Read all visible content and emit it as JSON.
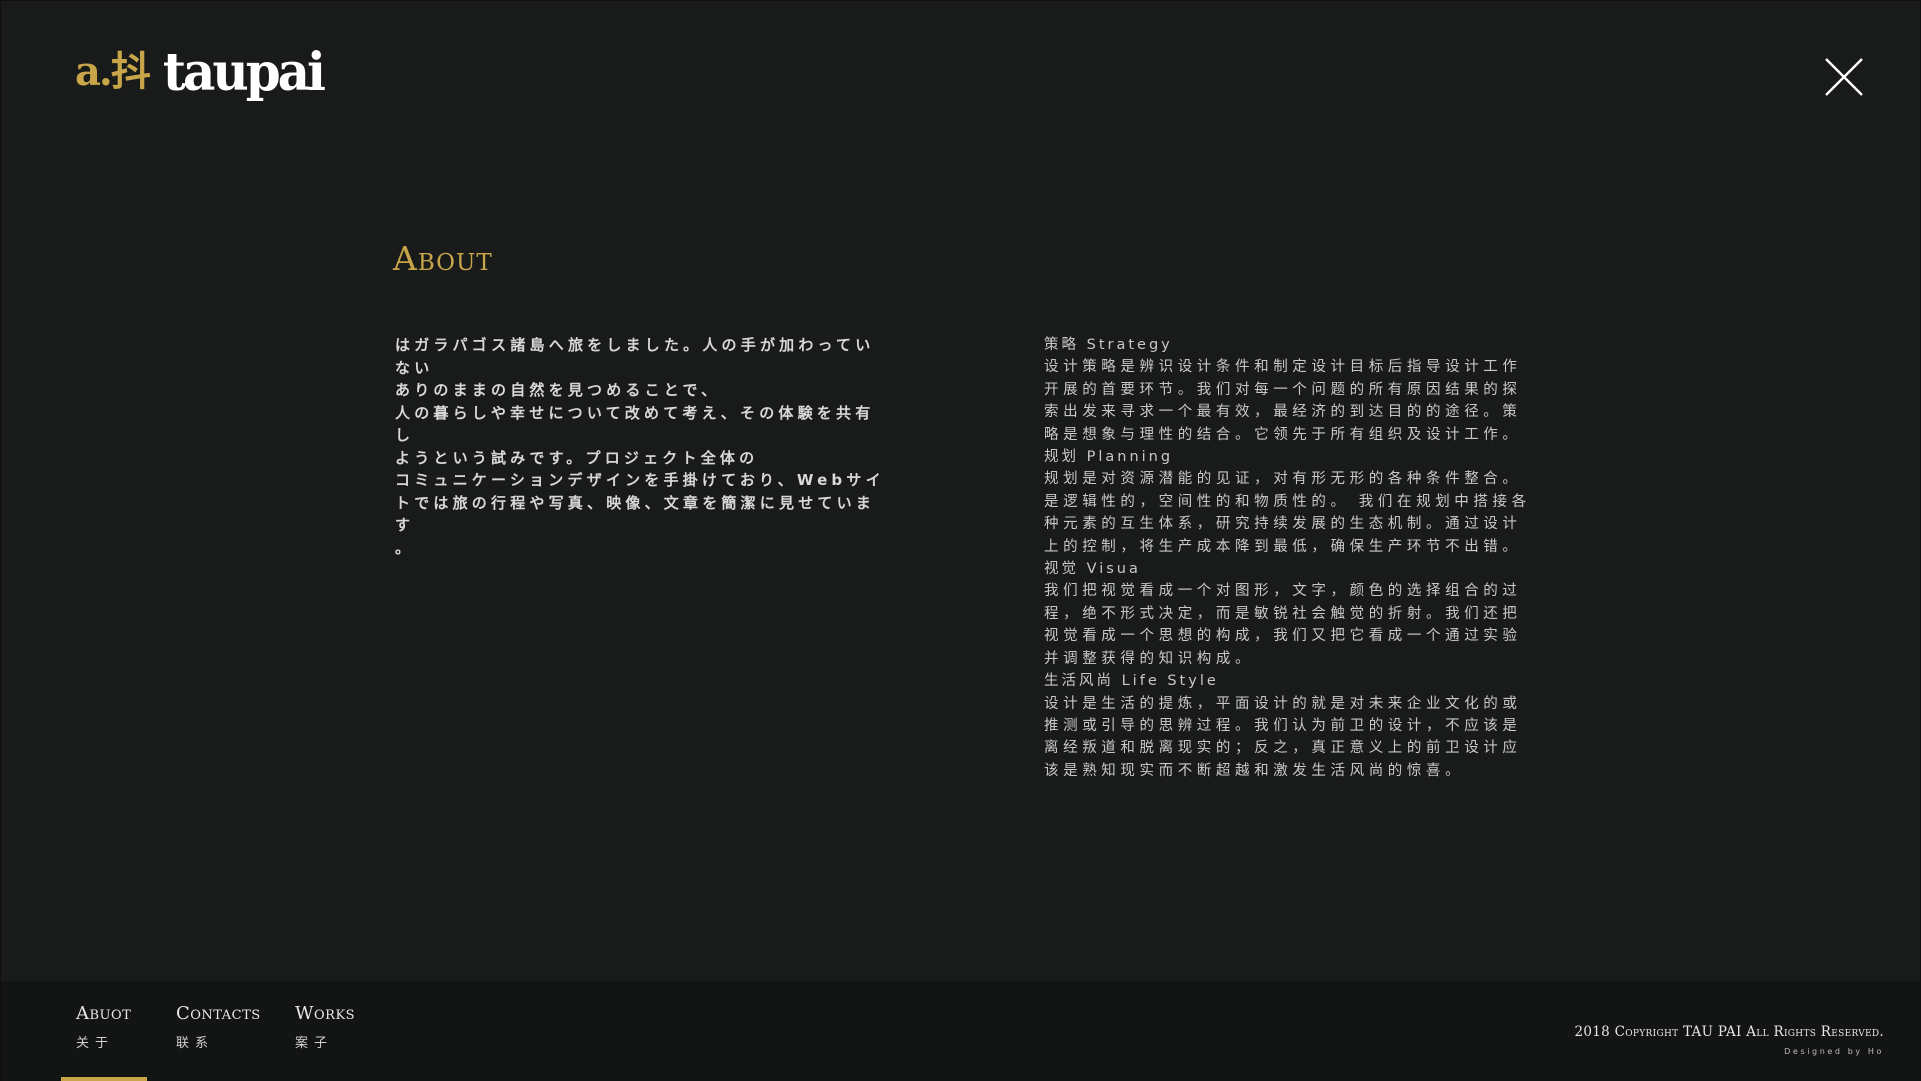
{
  "header": {
    "logo_mark": "a.抖",
    "logo_text": "taupai",
    "close_label": "close"
  },
  "about": {
    "title": "About",
    "jp_text": "はガラパゴス諸島へ旅をしました。人の手が加わっていない\nありのままの自然を見つめることで、\n人の暮らしや幸せについて改めて考え、その体験を共有し\nようという試みです。プロジェクト全体の\nコミュニケーションデザインを手掛けており、Webサイ\nトでは旅の行程や写真、映像、文章を簡潔に見せています\n。",
    "sections": [
      {
        "title": "策略 Strategy",
        "body": "设计策略是辨识设计条件和制定设计目标后指导设计工作开展的首要环节。我们对每一个问题的所有原因结果的探索出发来寻求一个最有效，最经济的到达目的的途径。策略是想象与理性的结合。它领先于所有组织及设计工作。"
      },
      {
        "title": "规划 Planning",
        "body": "规划是对资源潜能的见证，对有形无形的各种条件整合。是逻辑性的，空间性的和物质性的。 我们在规划中搭接各种元素的互生体系，研究持续发展的生态机制。通过设计上的控制，将生产成本降到最低，确保生产环节不出错。"
      },
      {
        "title": "视觉 Visua",
        "body": "我们把视觉看成一个对图形，文字，颜色的选择组合的过程，绝不形式决定，而是敏锐社会触觉的折射。我们还把视觉看成一个思想的构成，我们又把它看成一个通过实验并调整获得的知识构成。"
      },
      {
        "title": "生活风尚 Life Style",
        "body": "设计是生活的提炼，平面设计的就是对未来企业文化的或推测或引导的思辨过程。我们认为前卫的设计，不应该是离经叛道和脱离现实的；反之，真正意义上的前卫设计应该是熟知现实而不断超越和激发生活风尚的惊喜。"
      }
    ]
  },
  "footer": {
    "nav": [
      {
        "label_en": "Abuot",
        "label_cn": "关于"
      },
      {
        "label_en": "Contacts",
        "label_cn": "联系"
      },
      {
        "label_en": "Works",
        "label_cn": "案子"
      }
    ],
    "copyright": "2018 Copyright TAU PAI All Rights Reserved.",
    "designed_by": "Designed by Ho"
  },
  "colors": {
    "background": "#191b1a",
    "accent": "#c9a54a",
    "text": "#d8d8d8",
    "footer_bg": "#131514"
  },
  "icons": {
    "close": "close-icon"
  }
}
